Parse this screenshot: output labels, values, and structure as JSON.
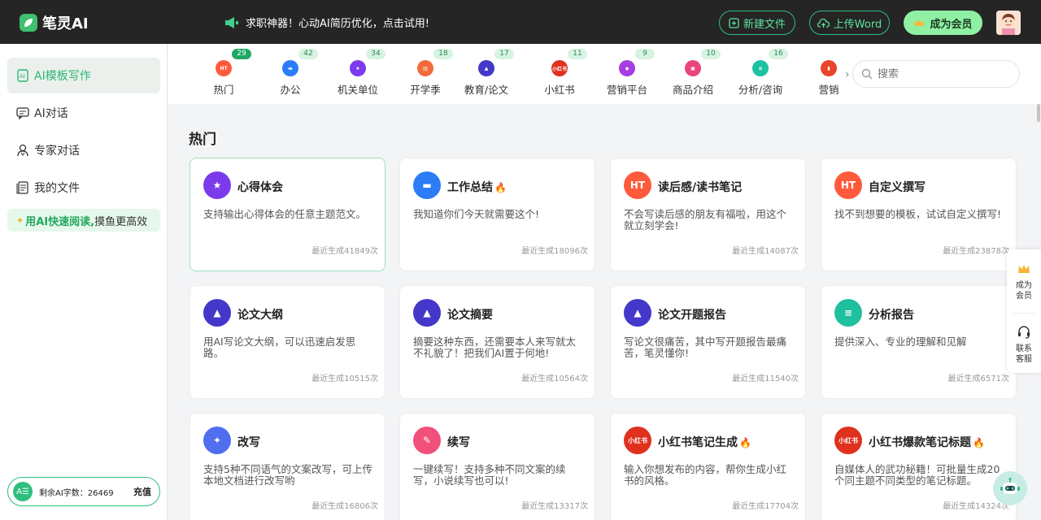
{
  "app": {
    "logo_text": "笔灵AI"
  },
  "header": {
    "promo_text": "求职神器！心动AI简历优化，点击试用!",
    "new_file_label": "新建文件",
    "upload_word_label": "上传Word",
    "member_label": "成为会员"
  },
  "sidebar": {
    "items": [
      {
        "label": "AI模板写作",
        "icon": "ai-template-icon",
        "active": true
      },
      {
        "label": "AI对话",
        "icon": "chat-icon"
      },
      {
        "label": "专家对话",
        "icon": "expert-icon"
      },
      {
        "label": "我的文件",
        "icon": "file-icon"
      }
    ],
    "promo_highlight": "用AI快速阅读,",
    "promo_rest": "摸鱼更高效",
    "quota_icon_text": "A☰",
    "quota_label": "剩余AI字数：26469",
    "recharge_label": "充值"
  },
  "categories": [
    {
      "label": "热门",
      "count": "29",
      "icon": "fire-icon",
      "color": "#ff5a3c",
      "icon_text": "HT",
      "highlight": true
    },
    {
      "label": "办公",
      "count": "42",
      "icon": "briefcase-icon",
      "color": "#2b7cf6",
      "icon_text": "▬"
    },
    {
      "label": "机关单位",
      "count": "34",
      "icon": "badge-icon",
      "color": "#7c3aed",
      "icon_text": "★"
    },
    {
      "label": "开学季",
      "count": "18",
      "icon": "book-icon",
      "color": "#f26b3a",
      "icon_text": "▥"
    },
    {
      "label": "教育/论文",
      "count": "17",
      "icon": "graduation-cap-icon",
      "color": "#4338ca",
      "icon_text": "▲"
    },
    {
      "label": "小红书",
      "count": "11",
      "icon": "xiaohongshu-icon",
      "color": "#e0301e",
      "icon_text": "小红书"
    },
    {
      "label": "营销平台",
      "count": "9",
      "icon": "tag-icon",
      "color": "#a63ee0",
      "icon_text": "◆"
    },
    {
      "label": "商品介绍",
      "count": "10",
      "icon": "shopping-bag-icon",
      "color": "#e8457a",
      "icon_text": "▣"
    },
    {
      "label": "分析/咨询",
      "count": "16",
      "icon": "document-icon",
      "color": "#1fc0a0",
      "icon_text": "≡"
    },
    {
      "label": "营销",
      "count": "",
      "icon": "chart-icon",
      "color": "#e9442c",
      "icon_text": "▮"
    }
  ],
  "search": {
    "placeholder": "搜索"
  },
  "main": {
    "section_title": "热门",
    "cards": [
      {
        "title": "心得体会",
        "desc": "支持输出心得体会的任意主题范文。",
        "count": "最近生成41849次",
        "icon": "badge-icon",
        "icon_text": "★",
        "color": "#7c3aed",
        "fire": false
      },
      {
        "title": "工作总结",
        "desc": "我知道你们今天就需要这个!",
        "count": "最近生成18096次",
        "icon": "briefcase-icon",
        "icon_text": "▬",
        "color": "#2b7cf6",
        "fire": true
      },
      {
        "title": "读后感/读书笔记",
        "desc": "不会写读后感的朋友有福啦，用这个就立刻学会!",
        "count": "最近生成14087次",
        "icon": "fire-icon",
        "icon_text": "HT",
        "color": "#ff5a3c",
        "fire": false
      },
      {
        "title": "自定义撰写",
        "desc": "找不到想要的模板，试试自定义撰写!",
        "count": "最近生成23878次",
        "icon": "fire-icon",
        "icon_text": "HT",
        "color": "#ff5a3c",
        "fire": false
      },
      {
        "title": "论文大纲",
        "desc": "用AI写论文大纲，可以迅速启发思路。",
        "count": "最近生成10515次",
        "icon": "graduation-cap-icon",
        "icon_text": "▲",
        "color": "#4338ca",
        "fire": false
      },
      {
        "title": "论文摘要",
        "desc": "摘要这种东西，还需要本人来写就太不礼貌了！把我们AI置于何地!",
        "count": "最近生成10564次",
        "icon": "graduation-cap-icon",
        "icon_text": "▲",
        "color": "#4338ca",
        "fire": false
      },
      {
        "title": "论文开题报告",
        "desc": "写论文很痛苦，其中写开题报告最痛苦，笔灵懂你!",
        "count": "最近生成11540次",
        "icon": "graduation-cap-icon",
        "icon_text": "▲",
        "color": "#4338ca",
        "fire": false
      },
      {
        "title": "分析报告",
        "desc": "提供深入、专业的理解和见解",
        "count": "最近生成6571次",
        "icon": "document-icon",
        "icon_text": "≡",
        "color": "#1fc0a0",
        "fire": false
      },
      {
        "title": "改写",
        "desc": "支持5种不同语气的文案改写，可上传本地文档进行改写哟",
        "count": "最近生成16806次",
        "icon": "rocket-icon",
        "icon_text": "✦",
        "color": "#4f6ef0",
        "fire": false
      },
      {
        "title": "续写",
        "desc": "一键续写！支持多种不同文案的续写，小说续写也可以!",
        "count": "最近生成13317次",
        "icon": "pen-icon",
        "icon_text": "✎",
        "color": "#f0507a",
        "fire": false
      },
      {
        "title": "小红书笔记生成",
        "desc": "输入你想发布的内容，帮你生成小红书的风格。",
        "count": "最近生成17704次",
        "icon": "xiaohongshu-icon",
        "icon_text": "小红书",
        "color": "#e0301e",
        "fire": true
      },
      {
        "title": "小红书爆款笔记标题",
        "desc": "自媒体人的武功秘籍！可批量生成20个同主题不同类型的笔记标题。",
        "count": "最近生成14324次",
        "icon": "xiaohongshu-icon",
        "icon_text": "小红书",
        "color": "#e0301e",
        "fire": true
      }
    ]
  },
  "float_panel": {
    "member_label": "成为会员",
    "service_label": "联系客服"
  }
}
